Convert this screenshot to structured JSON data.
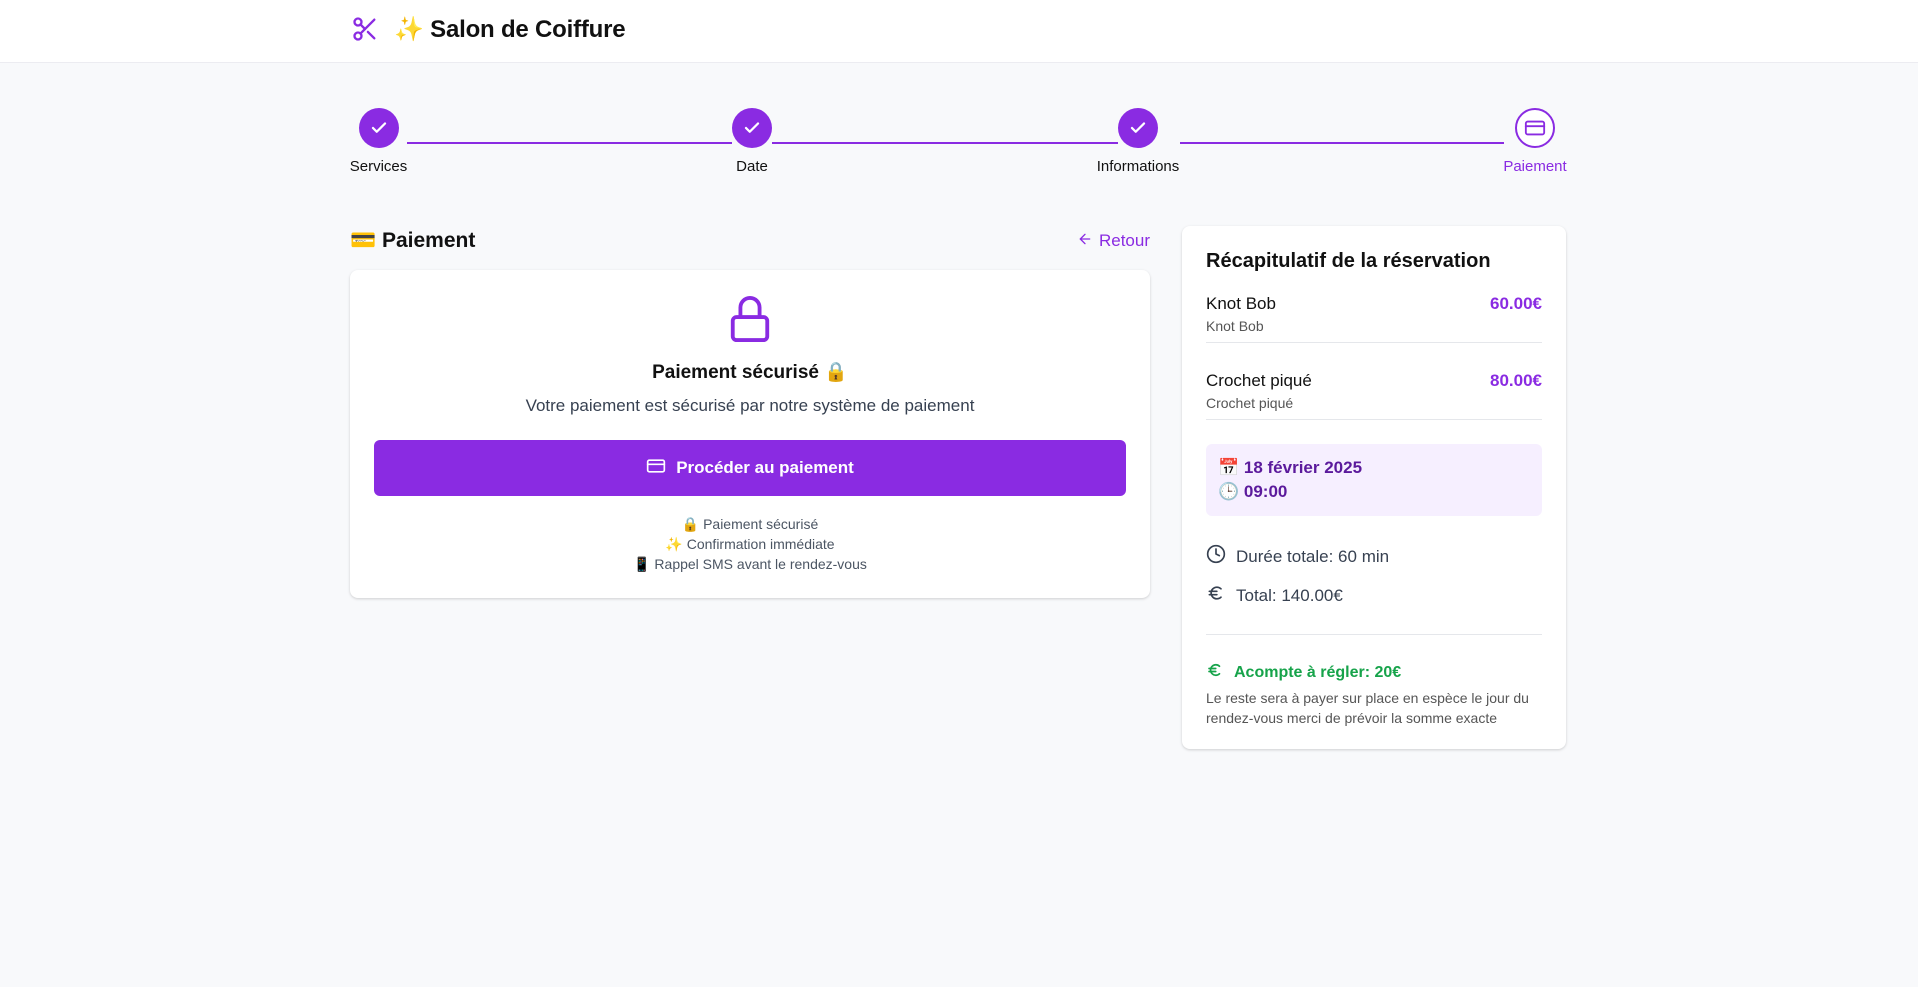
{
  "header": {
    "title": "✨ Salon de Coiffure",
    "logo_icon": "scissors-icon",
    "accent": "#8a2be2"
  },
  "stepper": {
    "steps": [
      {
        "label": "Services",
        "status": "done"
      },
      {
        "label": "Date",
        "status": "done"
      },
      {
        "label": "Informations",
        "status": "done"
      },
      {
        "label": "Paiement",
        "status": "current"
      }
    ]
  },
  "main": {
    "heading": "💳 Paiement",
    "back_label": "Retour",
    "card": {
      "title": "Paiement sécurisé 🔒",
      "description": "Votre paiement est sécurisé par notre système de paiement",
      "button_label": "Procéder au paiement",
      "features": [
        "🔒 Paiement sécurisé",
        "✨ Confirmation immédiate",
        "📱 Rappel SMS avant le rendez-vous"
      ]
    }
  },
  "summary": {
    "title": "Récapitulatif de la réservation",
    "services": [
      {
        "name": "Knot Bob",
        "subtitle": "Knot Bob",
        "price": "60.00€"
      },
      {
        "name": "Crochet piqué",
        "subtitle": "Crochet piqué",
        "price": "80.00€"
      }
    ],
    "date": "📅 18 février 2025",
    "time": "🕒 09:00",
    "duration": "Durée totale: 60 min",
    "total": "Total: 140.00€",
    "deposit": "Acompte à régler: 20€",
    "deposit_note": "Le reste sera à payer sur place en espèce le jour du rendez-vous merci de prévoir la somme exacte",
    "deposit_color": "#16a34a"
  }
}
